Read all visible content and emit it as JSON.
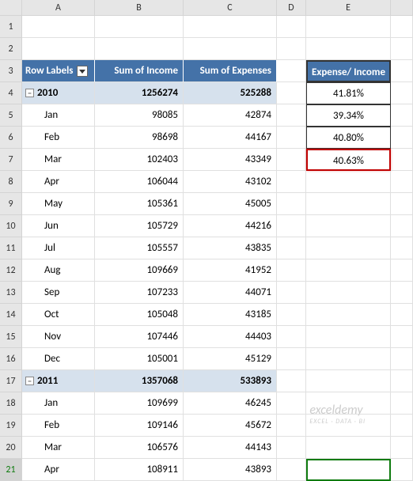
{
  "columns": [
    "A",
    "B",
    "C",
    "D",
    "E",
    ""
  ],
  "headers": {
    "row_labels": "Row Labels",
    "sum_income": "Sum of Income",
    "sum_expenses": "Sum of Expenses",
    "ratio": "Expense/ Income"
  },
  "ratios": [
    "41.81%",
    "39.34%",
    "40.80%",
    "40.63%"
  ],
  "rows": [
    {
      "n": "3",
      "type": "header"
    },
    {
      "n": "4",
      "type": "year",
      "label": "2010",
      "income": "1256274",
      "exp": "525288",
      "ratio_idx": 0
    },
    {
      "n": "5",
      "type": "month",
      "label": "Jan",
      "income": "98085",
      "exp": "42874",
      "ratio_idx": 1
    },
    {
      "n": "6",
      "type": "month",
      "label": "Feb",
      "income": "98698",
      "exp": "44167",
      "ratio_idx": 2
    },
    {
      "n": "7",
      "type": "month",
      "label": "Mar",
      "income": "102403",
      "exp": "43349",
      "ratio_idx": 3,
      "highlight": true
    },
    {
      "n": "8",
      "type": "month",
      "label": "Apr",
      "income": "106044",
      "exp": "43102"
    },
    {
      "n": "9",
      "type": "month",
      "label": "May",
      "income": "105361",
      "exp": "45005"
    },
    {
      "n": "10",
      "type": "month",
      "label": "Jun",
      "income": "105729",
      "exp": "44216"
    },
    {
      "n": "11",
      "type": "month",
      "label": "Jul",
      "income": "105557",
      "exp": "43835"
    },
    {
      "n": "12",
      "type": "month",
      "label": "Aug",
      "income": "109669",
      "exp": "41952"
    },
    {
      "n": "13",
      "type": "month",
      "label": "Sep",
      "income": "107233",
      "exp": "44071"
    },
    {
      "n": "14",
      "type": "month",
      "label": "Oct",
      "income": "105048",
      "exp": "43185"
    },
    {
      "n": "15",
      "type": "month",
      "label": "Nov",
      "income": "107446",
      "exp": "44403"
    },
    {
      "n": "16",
      "type": "month",
      "label": "Dec",
      "income": "105001",
      "exp": "45129"
    },
    {
      "n": "17",
      "type": "year",
      "label": "2011",
      "income": "1357068",
      "exp": "533893"
    },
    {
      "n": "18",
      "type": "month",
      "label": "Jan",
      "income": "109699",
      "exp": "46245"
    },
    {
      "n": "19",
      "type": "month",
      "label": "Feb",
      "income": "109146",
      "exp": "45672"
    },
    {
      "n": "20",
      "type": "month",
      "label": "Mar",
      "income": "106576",
      "exp": "44143"
    },
    {
      "n": "21",
      "type": "month",
      "label": "Apr",
      "income": "108911",
      "exp": "43893",
      "selected": true
    }
  ],
  "collapse_symbol": "−",
  "row_1": "1",
  "row_2": "2",
  "watermark": {
    "main": "exceldemy",
    "sub": "EXCEL · DATA · BI"
  }
}
